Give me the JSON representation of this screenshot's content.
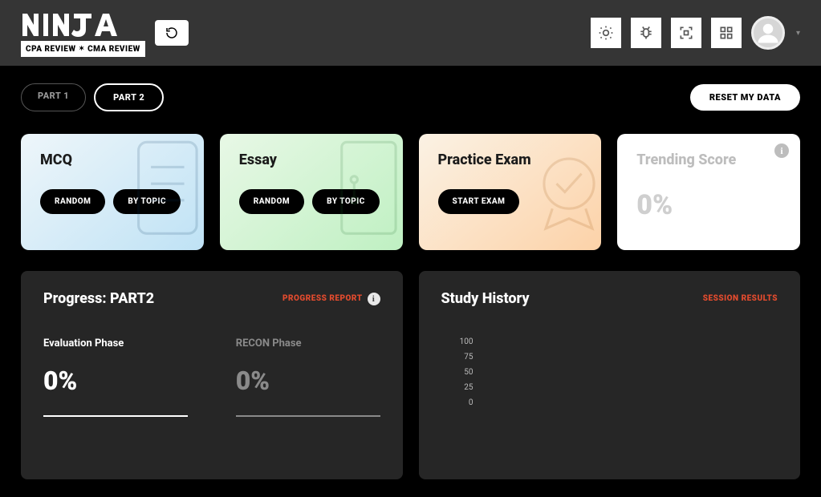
{
  "brand": {
    "review1": "CPA REVIEW",
    "review2": "CMA REVIEW"
  },
  "header": {
    "buttons": [
      "light-mode",
      "bug",
      "scan",
      "grid"
    ]
  },
  "tabs": [
    {
      "label": "PART 1",
      "active": false
    },
    {
      "label": "PART 2",
      "active": true
    }
  ],
  "reset_label": "RESET MY DATA",
  "cards": {
    "mcq": {
      "title": "MCQ",
      "random": "RANDOM",
      "bytopic": "BY TOPIC"
    },
    "essay": {
      "title": "Essay",
      "random": "RANDOM",
      "bytopic": "BY TOPIC"
    },
    "exam": {
      "title": "Practice Exam",
      "start": "START EXAM"
    },
    "trend": {
      "title": "Trending Score",
      "value": "0%"
    }
  },
  "progress": {
    "title": "Progress: PART2",
    "link": "PROGRESS REPORT",
    "phases": [
      {
        "name": "Evaluation Phase",
        "value": "0%",
        "active": true
      },
      {
        "name": "RECON Phase",
        "value": "0%",
        "active": false
      }
    ]
  },
  "history": {
    "title": "Study History",
    "link": "SESSION RESULTS"
  },
  "chart_data": {
    "type": "bar",
    "categories": [],
    "values": [],
    "title": "Study History",
    "xlabel": "",
    "ylabel": "",
    "ylim": [
      0,
      100
    ],
    "yticks": [
      100,
      75,
      50,
      25,
      0
    ]
  }
}
